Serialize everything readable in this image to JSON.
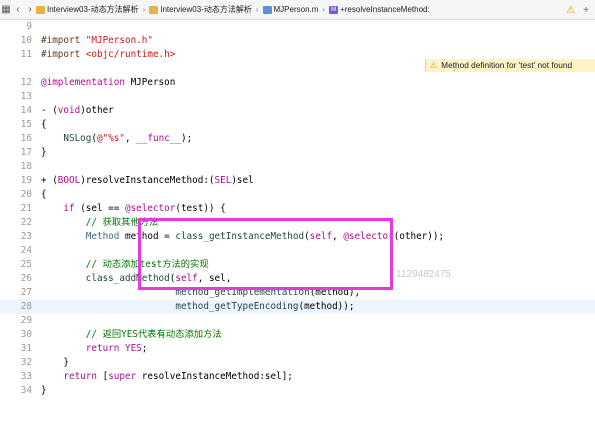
{
  "jumpbar": {
    "back_icon": "‹",
    "forward_icon": "›",
    "crumbs": [
      {
        "label": "Interview03-动态方法解析",
        "icon": "folder-icon"
      },
      {
        "label": "Interview03-动态方法解析",
        "icon": "folder-icon"
      },
      {
        "label": "MJPerson.m",
        "icon": "m-file-icon"
      },
      {
        "label": "+resolveInstanceMethod:",
        "icon": "method-icon"
      }
    ],
    "separator": "›",
    "method_glyph": "M",
    "warning_icon": "⚠",
    "add_icon": "+"
  },
  "warning": {
    "text": "Method definition for 'test' not found"
  },
  "watermark": "1129482475",
  "overlay": {
    "color": "#e23ae0"
  },
  "colors": {
    "keyword": "#aa0d91",
    "string": "#c41a16",
    "comment": "#007400",
    "current_line": "#ecf5fd"
  }
}
